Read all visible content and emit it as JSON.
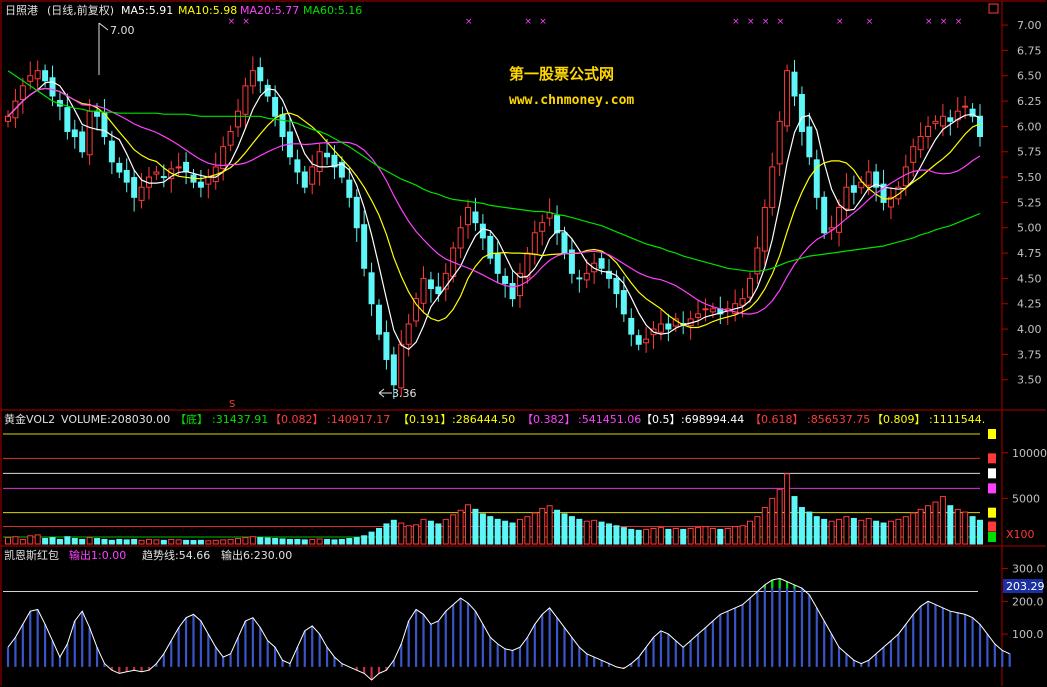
{
  "colors": {
    "up": "#ff3a3a",
    "down": "#5ef6f6",
    "ma5": "#ffffff",
    "ma10": "#ffff00",
    "ma20": "#ff40ff",
    "ma60": "#00e000",
    "frame": "#b00000",
    "volbar_up": "#ff3a3a",
    "volbar_down": "#5ef6f6"
  },
  "main": {
    "title": "日照港",
    "subtitle": "(日线,前复权)",
    "ma5": "MA5:5.91",
    "ma10": "MA10:5.98",
    "ma20": "MA20:5.77",
    "ma60": "MA60:5.16",
    "high_label": "7.00",
    "low_label": "3.36",
    "watermark_cn": "第一股票公式网",
    "watermark_url": "www.chnmoney.com",
    "s_marker": "S",
    "window_icon": "restore-icon"
  },
  "volume": {
    "name": "黄金VOL2",
    "volume_text": "VOLUME:208030.00",
    "bottom_label": "【底】",
    "bottom_value": ":31437.91",
    "l0082": "【0.082】",
    "v0082": ":140917.17",
    "l0191": "【0.191】",
    "v0191": ":286444.50",
    "l0382": "【0.382】",
    "v0382": ":541451.06",
    "l05": "【0.5】",
    "v05": ":698994.44",
    "l0618": "【0.618】",
    "v0618": ":856537.75",
    "l0809": "【0.809】",
    "v0809": ":1111544.",
    "unit": "X100"
  },
  "indicator": {
    "name": "凯恩斯红包",
    "out1": "输出1:0.00",
    "trend": "趋势线:54.66",
    "out6": "输出6:230.00",
    "current": "203.29"
  },
  "chart_data": [
    {
      "type": "candlestick",
      "title": "日照港",
      "ylim": [
        3.3,
        7.05
      ],
      "yticks": [
        "7.00",
        "6.75",
        "6.50",
        "6.25",
        "6.00",
        "5.75",
        "5.50",
        "5.25",
        "5.00",
        "4.75",
        "4.50",
        "4.25",
        "4.00",
        "3.75",
        "3.50"
      ],
      "highest": 7.0,
      "lowest": 3.36,
      "series": [
        {
          "name": "MA5"
        },
        {
          "name": "MA10"
        },
        {
          "name": "MA20"
        },
        {
          "name": "MA60"
        }
      ],
      "closes": [
        6.1,
        6.25,
        6.4,
        6.5,
        6.55,
        6.45,
        6.3,
        6.2,
        5.95,
        5.9,
        5.75,
        6.15,
        6.1,
        5.9,
        5.65,
        5.55,
        5.45,
        5.3,
        5.4,
        5.5,
        5.55,
        5.5,
        5.58,
        5.6,
        5.55,
        5.45,
        5.4,
        5.5,
        5.6,
        5.8,
        5.95,
        6.15,
        6.4,
        6.55,
        6.45,
        6.3,
        6.1,
        5.9,
        5.7,
        5.55,
        5.4,
        5.6,
        5.75,
        5.7,
        5.6,
        5.5,
        5.3,
        5.0,
        4.6,
        4.25,
        3.95,
        3.7,
        3.45,
        3.85,
        4.05,
        4.3,
        4.5,
        4.4,
        4.35,
        4.55,
        4.8,
        5.0,
        5.2,
        5.05,
        4.9,
        4.7,
        4.55,
        4.45,
        4.3,
        4.55,
        4.75,
        4.95,
        5.05,
        5.15,
        4.95,
        4.75,
        4.55,
        4.5,
        4.55,
        4.65,
        4.6,
        4.5,
        4.35,
        4.15,
        3.95,
        3.85,
        3.9,
        4.0,
        4.05,
        4.0,
        4.1,
        4.05,
        4.1,
        4.15,
        4.2,
        4.2,
        4.15,
        4.2,
        4.25,
        4.3,
        4.5,
        4.8,
        5.2,
        5.6,
        6.05,
        6.55,
        6.3,
        5.95,
        5.7,
        5.3,
        4.95,
        5.0,
        5.2,
        5.4,
        5.35,
        5.45,
        5.55,
        5.4,
        5.25,
        5.3,
        5.4,
        5.6,
        5.8,
        5.9,
        6.0,
        6.05,
        6.1,
        6.05,
        6.15,
        6.2,
        6.1,
        5.9
      ],
      "ma60": [
        6.55,
        6.5,
        6.45,
        6.4,
        6.35,
        6.3,
        6.25,
        6.22,
        6.2,
        6.18,
        6.17,
        6.15,
        6.15,
        6.14,
        6.14,
        6.13,
        6.13,
        6.13,
        6.13,
        6.13,
        6.13,
        6.12,
        6.12,
        6.12,
        6.12,
        6.11,
        6.1,
        6.1,
        6.1,
        6.1,
        6.1,
        6.1,
        6.1,
        6.1,
        6.1,
        6.08,
        6.07,
        6.06,
        6.05,
        6.03,
        6.0,
        5.97,
        5.95,
        5.92,
        5.88,
        5.84,
        5.8,
        5.75,
        5.7,
        5.65,
        5.6,
        5.56,
        5.52,
        5.48,
        5.45,
        5.42,
        5.38,
        5.35,
        5.33,
        5.3,
        5.28,
        5.27,
        5.26,
        5.25,
        5.24,
        5.22,
        5.21,
        5.2,
        5.19,
        5.18,
        5.17,
        5.16,
        5.16,
        5.15,
        5.13,
        5.12,
        5.1,
        5.08,
        5.06,
        5.04,
        5.02,
        4.99,
        4.96,
        4.93,
        4.9,
        4.87,
        4.84,
        4.82,
        4.8,
        4.77,
        4.75,
        4.72,
        4.7,
        4.68,
        4.66,
        4.64,
        4.62,
        4.6,
        4.59,
        4.58,
        4.57,
        4.57,
        4.58,
        4.6,
        4.63,
        4.66,
        4.68,
        4.7,
        4.72,
        4.73,
        4.74,
        4.75,
        4.76,
        4.77,
        4.78,
        4.79,
        4.8,
        4.81,
        4.82,
        4.84,
        4.86,
        4.88,
        4.9,
        4.93,
        4.95,
        4.98,
        5.0,
        5.02,
        5.05,
        5.08,
        5.11,
        5.14
      ]
    },
    {
      "type": "bar",
      "title": "黄金VOL2",
      "unit": "X100",
      "yticks": [
        "10000",
        "5000"
      ],
      "ylim": [
        0,
        12500
      ],
      "levels": [
        {
          "name": "底",
          "value": 31437.91
        },
        {
          "name": "0.082",
          "value": 140917.17
        },
        {
          "name": "0.191",
          "value": 286444.5
        },
        {
          "name": "0.382",
          "value": 541451.06
        },
        {
          "name": "0.5",
          "value": 698994.44
        },
        {
          "name": "0.618",
          "value": 856537.75
        },
        {
          "name": "0.809",
          "value": 1111544
        }
      ],
      "values": [
        700,
        800,
        500,
        900,
        1000,
        600,
        700,
        500,
        800,
        600,
        500,
        700,
        600,
        500,
        400,
        500,
        450,
        500,
        400,
        500,
        450,
        400,
        500,
        450,
        400,
        380,
        400,
        350,
        400,
        450,
        500,
        600,
        700,
        800,
        700,
        650,
        600,
        550,
        500,
        500,
        450,
        500,
        550,
        500,
        450,
        500,
        600,
        700,
        900,
        1300,
        1700,
        2200,
        2600,
        2300,
        2000,
        2100,
        2700,
        2500,
        2200,
        2700,
        3200,
        3700,
        4300,
        3800,
        3300,
        3000,
        2700,
        2500,
        2300,
        2700,
        3000,
        3400,
        3900,
        4200,
        3700,
        3300,
        3000,
        2700,
        2500,
        2600,
        2400,
        2200,
        2000,
        1800,
        1600,
        1500,
        1600,
        1700,
        1800,
        1600,
        1700,
        1600,
        1700,
        1800,
        1900,
        1700,
        1600,
        1700,
        1900,
        2000,
        2500,
        3000,
        4000,
        5000,
        6000,
        7700,
        5200,
        4000,
        3500,
        3000,
        2700,
        2500,
        2700,
        3000,
        2800,
        2600,
        2800,
        2500,
        2300,
        2500,
        2700,
        3000,
        3400,
        3800,
        4200,
        4600,
        5200,
        4200,
        3800,
        3500,
        3000,
        2600
      ]
    },
    {
      "type": "bar",
      "title": "凯恩斯红包",
      "ylim": [
        -40,
        320
      ],
      "yticks": [
        "300.0",
        "200.0",
        "100.0"
      ],
      "reference": 230,
      "current": 203.29,
      "values": [
        60,
        90,
        130,
        170,
        175,
        130,
        80,
        30,
        70,
        140,
        170,
        120,
        60,
        10,
        -10,
        -20,
        -15,
        -10,
        -15,
        -10,
        10,
        40,
        80,
        120,
        150,
        160,
        140,
        100,
        60,
        30,
        40,
        90,
        140,
        150,
        120,
        80,
        60,
        20,
        10,
        60,
        110,
        125,
        100,
        60,
        30,
        10,
        0,
        -10,
        -20,
        -40,
        -20,
        -10,
        20,
        70,
        140,
        175,
        160,
        130,
        140,
        170,
        190,
        210,
        195,
        170,
        130,
        90,
        70,
        55,
        50,
        60,
        90,
        130,
        160,
        180,
        150,
        120,
        90,
        60,
        40,
        30,
        20,
        10,
        0,
        -5,
        10,
        30,
        60,
        90,
        110,
        100,
        80,
        60,
        80,
        100,
        120,
        140,
        160,
        170,
        180,
        190,
        210,
        230,
        250,
        265,
        270,
        260,
        250,
        240,
        220,
        180,
        140,
        100,
        60,
        40,
        20,
        10,
        20,
        40,
        60,
        80,
        100,
        130,
        160,
        185,
        200,
        190,
        180,
        170,
        165,
        160,
        150,
        130,
        100,
        70,
        50,
        40
      ]
    }
  ]
}
